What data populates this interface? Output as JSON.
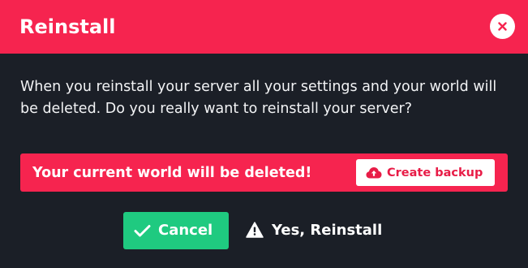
{
  "dialog": {
    "title": "Reinstall",
    "close_icon": "close-icon",
    "message": "When you reinstall your server all your settings and your world will be deleted. Do you really want to reinstall your server?"
  },
  "alert": {
    "text": "Your current world will be deleted!",
    "backup_button": {
      "label": "Create backup",
      "icon": "cloud-upload-icon"
    }
  },
  "actions": {
    "cancel": {
      "label": "Cancel",
      "icon": "check-icon"
    },
    "confirm": {
      "label": "Yes, Reinstall",
      "icon": "warning-icon"
    }
  },
  "colors": {
    "accent": "#f6244f",
    "background": "#1b1f27",
    "success": "#1fca80",
    "text": "#ffffff"
  }
}
